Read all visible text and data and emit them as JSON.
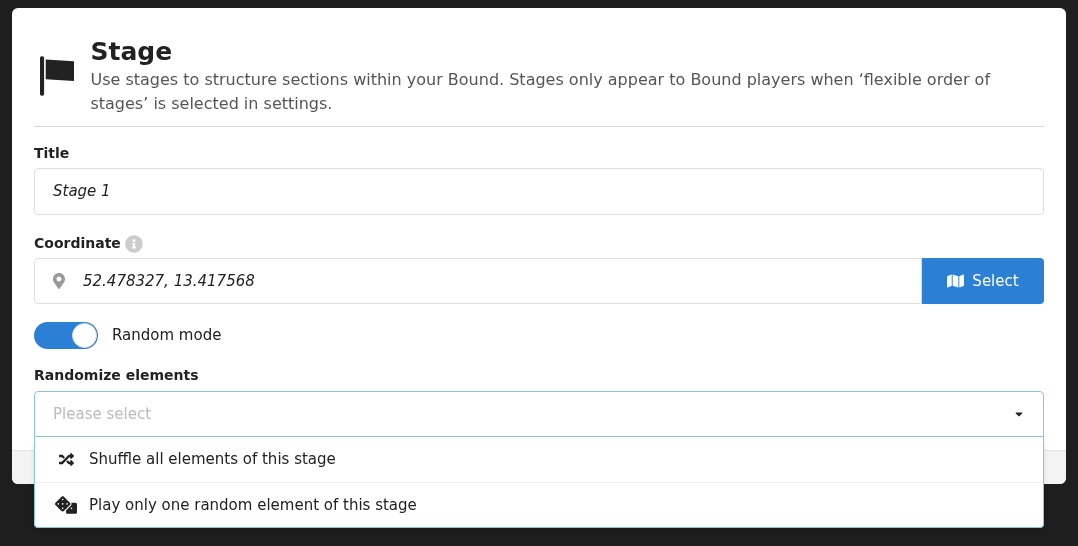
{
  "dialog": {
    "title": "Stage",
    "description": "Use stages to structure sections within your Bound. Stages only appear to Bound players when ‘flexible order of stages’ is selected in settings."
  },
  "title_field": {
    "label": "Title",
    "value": "Stage 1"
  },
  "coordinate_field": {
    "label": "Coordinate",
    "value": "52.478327, 13.417568",
    "button": "Select"
  },
  "random_mode": {
    "label": "Random mode",
    "on": true
  },
  "randomize": {
    "label": "Randomize elements",
    "placeholder": "Please select",
    "expanded": true,
    "options": [
      {
        "kind": "shuffle",
        "label": "Shuffle all elements of this stage"
      },
      {
        "kind": "dice",
        "label": "Play only one random element of this stage"
      }
    ]
  }
}
